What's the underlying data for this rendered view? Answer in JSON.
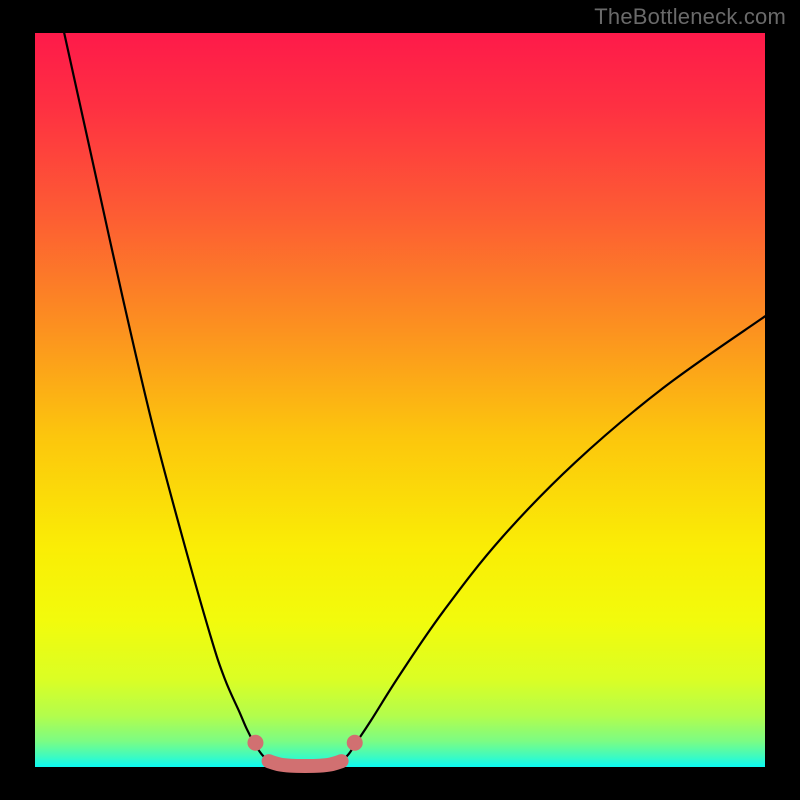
{
  "watermark": "TheBottleneck.com",
  "chart_data": {
    "type": "line",
    "title": "",
    "xlabel": "",
    "ylabel": "",
    "xlim": [
      0,
      100
    ],
    "ylim": [
      0,
      100
    ],
    "series": [
      {
        "name": "curve-left",
        "x": [
          4,
          8,
          12,
          16,
          20,
          24,
          26,
          28,
          29,
          30,
          31,
          32
        ],
        "y": [
          100,
          82,
          64,
          47,
          32,
          18,
          12,
          7.5,
          5.2,
          3.3,
          1.8,
          0.8
        ]
      },
      {
        "name": "curve-right",
        "x": [
          42,
          43,
          44,
          46,
          50,
          56,
          64,
          74,
          86,
          100
        ],
        "y": [
          0.8,
          1.8,
          3.3,
          6.3,
          12.6,
          21.3,
          31.3,
          41.5,
          51.6,
          61.4
        ]
      },
      {
        "name": "floor-band",
        "x": [
          32,
          33.5,
          35,
          37,
          39,
          40.5,
          42
        ],
        "y": [
          0.8,
          0.35,
          0.18,
          0.14,
          0.18,
          0.35,
          0.8
        ]
      }
    ],
    "markers": {
      "name": "dots",
      "x": [
        30.2,
        43.8
      ],
      "y": [
        3.3,
        3.3
      ]
    },
    "gradient_stops": [
      {
        "offset": 0.0,
        "color": "#fe1a4a"
      },
      {
        "offset": 0.1,
        "color": "#fe3042"
      },
      {
        "offset": 0.25,
        "color": "#fd5d33"
      },
      {
        "offset": 0.4,
        "color": "#fc9020"
      },
      {
        "offset": 0.55,
        "color": "#fcc60d"
      },
      {
        "offset": 0.7,
        "color": "#faed05"
      },
      {
        "offset": 0.8,
        "color": "#f2fb0c"
      },
      {
        "offset": 0.88,
        "color": "#dbfe24"
      },
      {
        "offset": 0.93,
        "color": "#b3fd4c"
      },
      {
        "offset": 0.965,
        "color": "#7bfc84"
      },
      {
        "offset": 0.985,
        "color": "#40fbbe"
      },
      {
        "offset": 1.0,
        "color": "#0bfaf2"
      }
    ],
    "curve_stroke": "#000000",
    "floor_stroke": "#d17071",
    "marker_fill": "#d17071"
  }
}
